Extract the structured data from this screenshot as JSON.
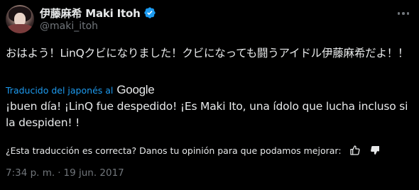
{
  "author": {
    "display_name": "伊藤麻希 Maki Itoh",
    "handle": "@maki_itoh",
    "verified": true,
    "verified_color": "#1d9bf0"
  },
  "tweet": {
    "original_text": "おはよう！LinQクビになりました！クビになっても闘うアイドル伊藤麻希だよ！！",
    "translated_by_label": "Traducido del japonés al",
    "translator_brand": "Google",
    "translated_text": "¡buen día! ¡LinQ fue despedido! ¡Es Maki Ito, una ídolo que lucha incluso si la despiden! !",
    "feedback_question": "¿Esta traducción es correcta? Danos tu opinión para que podamos mejorar:",
    "time": "7:34 p. m.",
    "separator": "·",
    "date": "19 jun. 2017"
  },
  "icons": {
    "more": "more-horizontal-icon",
    "verified": "verified-badge-icon",
    "thumbs_up": "thumbs-up-icon",
    "thumbs_down": "thumbs-down-icon"
  },
  "colors": {
    "background": "#000000",
    "text_primary": "#e7e9ea",
    "text_secondary": "#71767b",
    "link": "#1d9bf0"
  }
}
